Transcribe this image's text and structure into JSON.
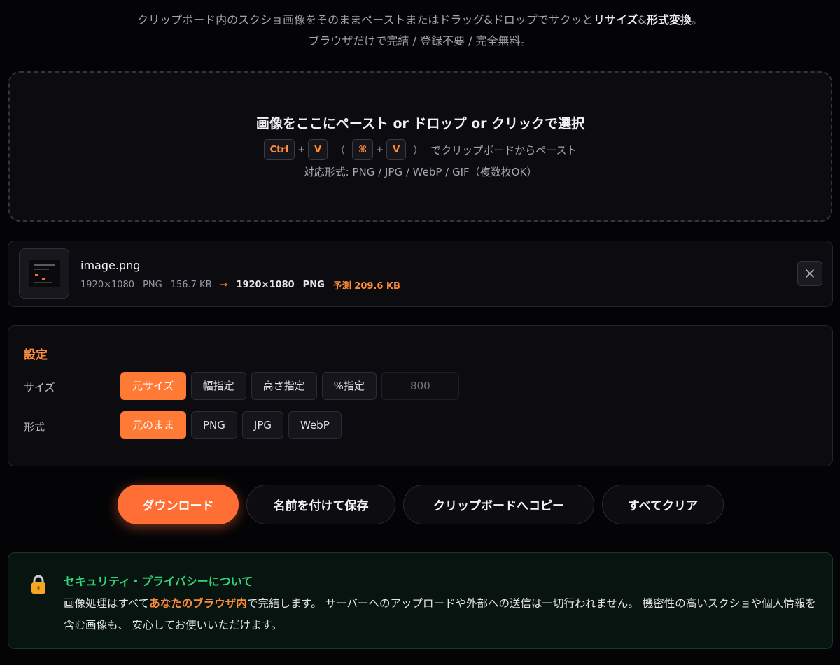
{
  "intro": {
    "line1_a": "クリップボード内のスクショ画像をそのままペーストまたはドラッグ&ドロップでサクッと",
    "line1_b": "リサイズ",
    "line1_c": "&",
    "line1_d": "形式変換",
    "line1_e": "。",
    "line2": "ブラウザだけで完結 / 登録不要 / 完全無料。"
  },
  "dropzone": {
    "title": "画像をここにペースト or ドロップ or クリックで選択",
    "key_ctrl": "Ctrl",
    "key_v": "V",
    "key_cmd": "⌘",
    "plus": "+",
    "paren_open": "（",
    "paren_close": "）",
    "paste_suffix": "でクリップボードからペースト",
    "formats": "対応形式: PNG / JPG / WebP / GIF（複数枚OK）"
  },
  "file": {
    "name": "image.png",
    "src_dims": "1920×1080",
    "src_format": "PNG",
    "src_size": "156.7 KB",
    "arrow": "→",
    "out_dims": "1920×1080",
    "out_format": "PNG",
    "estimate": "予測 209.6 KB",
    "close_icon": "×"
  },
  "settings": {
    "title": "設定",
    "size_label": "サイズ",
    "size_options": [
      "元サイズ",
      "幅指定",
      "高さ指定",
      "%指定"
    ],
    "size_active": "元サイズ",
    "size_input_placeholder": "800",
    "format_label": "形式",
    "format_options": [
      "元のまま",
      "PNG",
      "JPG",
      "WebP"
    ],
    "format_active": "元のまま"
  },
  "actions": {
    "download": "ダウンロード",
    "save_as": "名前を付けて保存",
    "copy_clipboard": "クリップボードへコピー",
    "clear_all": "すべてクリア"
  },
  "security": {
    "title": "セキュリティ・プライバシーについて",
    "body_a": "画像処理はすべて",
    "body_hl": "あなたのブラウザ内",
    "body_b": "で完結します。 サーバーへのアップロードや外部への送信は一切行われません。 機密性の高いスクショや個人情報を含む画像も、 安心してお使いいただけます。"
  },
  "colors": {
    "accent": "#ff7a35",
    "security_green": "#30d97a",
    "background": "#040406"
  },
  "icons": {
    "close": "close-icon",
    "lock": "lock-icon",
    "file_thumbnail": "image-thumbnail"
  }
}
